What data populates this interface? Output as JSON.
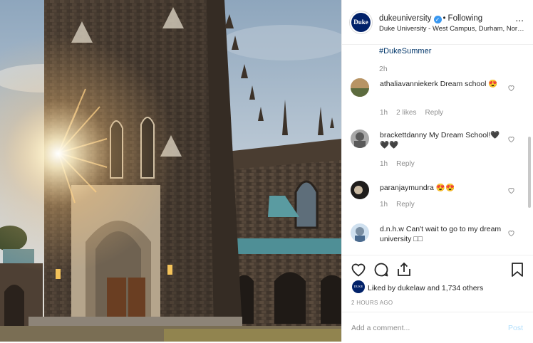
{
  "post": {
    "username": "dukeuniversity",
    "verified_mark": "✓",
    "separator": "•",
    "follow_status": "Following",
    "location": "Duke University - West Campus, Durham, North Carolina",
    "avatar_text": "Duke",
    "more_label": "...",
    "hashtag": "#DukeSummer",
    "caption_age": "2h",
    "liked_by_text": "Liked by dukelaw and 1,734 others",
    "liked_avatar_text": "DUKE LAW",
    "timestamp": "2 HOURS AGO",
    "add_comment_placeholder": "Add a comment...",
    "post_button": "Post"
  },
  "comments": [
    {
      "user": "athaliavanniekerk",
      "text": "Dream school 😍",
      "age": "1h",
      "likes": "2 likes",
      "reply": "Reply"
    },
    {
      "user": "brackettdanny",
      "text": "My Dream School!🖤🖤🖤",
      "age": "1h",
      "reply": "Reply"
    },
    {
      "user": "paranjaymundra",
      "text": "😍😍",
      "age": "1h",
      "reply": "Reply"
    },
    {
      "user": "d.n.h.w",
      "text": "Can't wait to go to my dream university □□",
      "age": "",
      "reply": ""
    }
  ],
  "icons": {
    "heart": "heart-icon",
    "comment": "comment-icon",
    "share": "share-icon",
    "save": "bookmark-icon",
    "more": "more-options-icon",
    "verified": "verified-badge-icon"
  },
  "colors": {
    "link_blue": "#003569",
    "verified_blue": "#3897f0",
    "muted_text": "#8e8e8e",
    "post_button_disabled": "#b2dffc",
    "duke_navy": "#012169"
  }
}
